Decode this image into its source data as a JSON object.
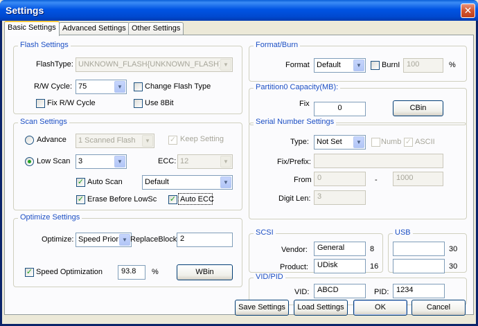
{
  "window": {
    "title": "Settings",
    "close_glyph": "✕"
  },
  "tabs": [
    "Basic Settings",
    "Advanced Settings",
    "Other Settings"
  ],
  "flash": {
    "title": "Flash Settings",
    "flash_type_label": "FlashType:",
    "flash_type_value": "UNKNOWN_FLASH{UNKNOWN_FLASH}",
    "rw_cycle_label": "R/W Cycle:",
    "rw_cycle_value": "75",
    "change_flash_type": "Change Flash Type",
    "fix_rw_cycle": "Fix R/W Cycle",
    "use_8bit": "Use 8Bit"
  },
  "scan": {
    "title": "Scan Settings",
    "advance": "Advance",
    "advance_value": "1 Scanned Flash",
    "keep_setting": "Keep Setting",
    "low_scan": "Low Scan",
    "low_scan_value": "3",
    "ecc_label": "ECC:",
    "ecc_value": "12",
    "auto_scan": "Auto Scan",
    "auto_scan_value": "Default",
    "erase_before": "Erase Before LowSc",
    "auto_ecc": "Auto ECC"
  },
  "optimize": {
    "title": "Optimize Settings",
    "optimize_label": "Optimize:",
    "optimize_value": "Speed Priori",
    "replace_block_label": "ReplaceBlock",
    "replace_block_value": "2",
    "speed_opt": "Speed Optimization",
    "speed_value": "93.8",
    "percent": "%",
    "wbin": "WBin"
  },
  "format": {
    "title": "Format/Burn",
    "format_label": "Format",
    "format_value": "Default",
    "burni": "BurnI",
    "burni_value": "100",
    "percent": "%"
  },
  "partition": {
    "title": "Partition0 Capacity(MB):",
    "fix_label": "Fix",
    "fix_value": "0",
    "cbin": "CBin"
  },
  "serial": {
    "title": "Serial Number Settings",
    "type_label": "Type:",
    "type_value": "Not Set",
    "numb": "Numb",
    "ascii": "ASCII",
    "fix_prefix_label": "Fix/Prefix:",
    "fix_prefix_value": "",
    "from_label": "From",
    "from_value": "0",
    "dash": "-",
    "to_value": "1000",
    "digit_len_label": "Digit Len:",
    "digit_len_value": "3"
  },
  "scsi": {
    "title": "SCSI",
    "vendor_label": "Vendor:",
    "vendor_value": "General",
    "vendor_len": "8",
    "product_label": "Product:",
    "product_value": "UDisk",
    "product_len": "16"
  },
  "usb": {
    "title": "USB",
    "field1_value": "",
    "field1_len": "30",
    "field2_value": "",
    "field2_len": "30"
  },
  "vidpid": {
    "title": "VID/PID",
    "vid_label": "VID:",
    "vid_value": "ABCD",
    "pid_label": "PID:",
    "pid_value": "1234"
  },
  "buttons": {
    "save": "Save Settings",
    "load": "Load Settings",
    "ok": "OK",
    "cancel": "Cancel"
  },
  "glyphs": {
    "check": "✓",
    "arrow": "▼"
  },
  "colors": {
    "title_bar": "#0054e3",
    "group_title": "#1c4fc4",
    "check": "#21a121"
  }
}
